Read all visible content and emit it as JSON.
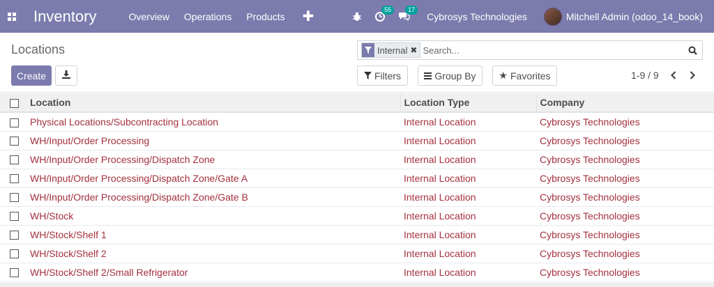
{
  "navbar": {
    "app_title": "Inventory",
    "menu": [
      "Overview",
      "Operations",
      "Products"
    ],
    "activity_badge": "55",
    "messages_badge": "17",
    "company": "Cybrosys Technologies",
    "user": "Mitchell Admin (odoo_14_book)"
  },
  "control_panel": {
    "breadcrumb": "Locations",
    "create_label": "Create",
    "search": {
      "facet_label": "Internal",
      "placeholder": "Search..."
    },
    "filters_label": "Filters",
    "groupby_label": "Group By",
    "favorites_label": "Favorites",
    "pager": "1-9 / 9"
  },
  "table": {
    "columns": [
      "Location",
      "Location Type",
      "Company"
    ],
    "rows": [
      {
        "location": "Physical Locations/Subcontracting Location",
        "type": "Internal Location",
        "company": "Cybrosys Technologies"
      },
      {
        "location": "WH/Input/Order Processing",
        "type": "Internal Location",
        "company": "Cybrosys Technologies"
      },
      {
        "location": "WH/Input/Order Processing/Dispatch Zone",
        "type": "Internal Location",
        "company": "Cybrosys Technologies"
      },
      {
        "location": "WH/Input/Order Processing/Dispatch Zone/Gate A",
        "type": "Internal Location",
        "company": "Cybrosys Technologies"
      },
      {
        "location": "WH/Input/Order Processing/Dispatch Zone/Gate B",
        "type": "Internal Location",
        "company": "Cybrosys Technologies"
      },
      {
        "location": "WH/Stock",
        "type": "Internal Location",
        "company": "Cybrosys Technologies"
      },
      {
        "location": "WH/Stock/Shelf 1",
        "type": "Internal Location",
        "company": "Cybrosys Technologies"
      },
      {
        "location": "WH/Stock/Shelf 2",
        "type": "Internal Location",
        "company": "Cybrosys Technologies"
      },
      {
        "location": "WH/Stock/Shelf 2/Small Refrigerator",
        "type": "Internal Location",
        "company": "Cybrosys Technologies"
      }
    ]
  },
  "colors": {
    "brand": "#7c7bad",
    "link": "#a3303d",
    "badge": "#00a09d"
  }
}
